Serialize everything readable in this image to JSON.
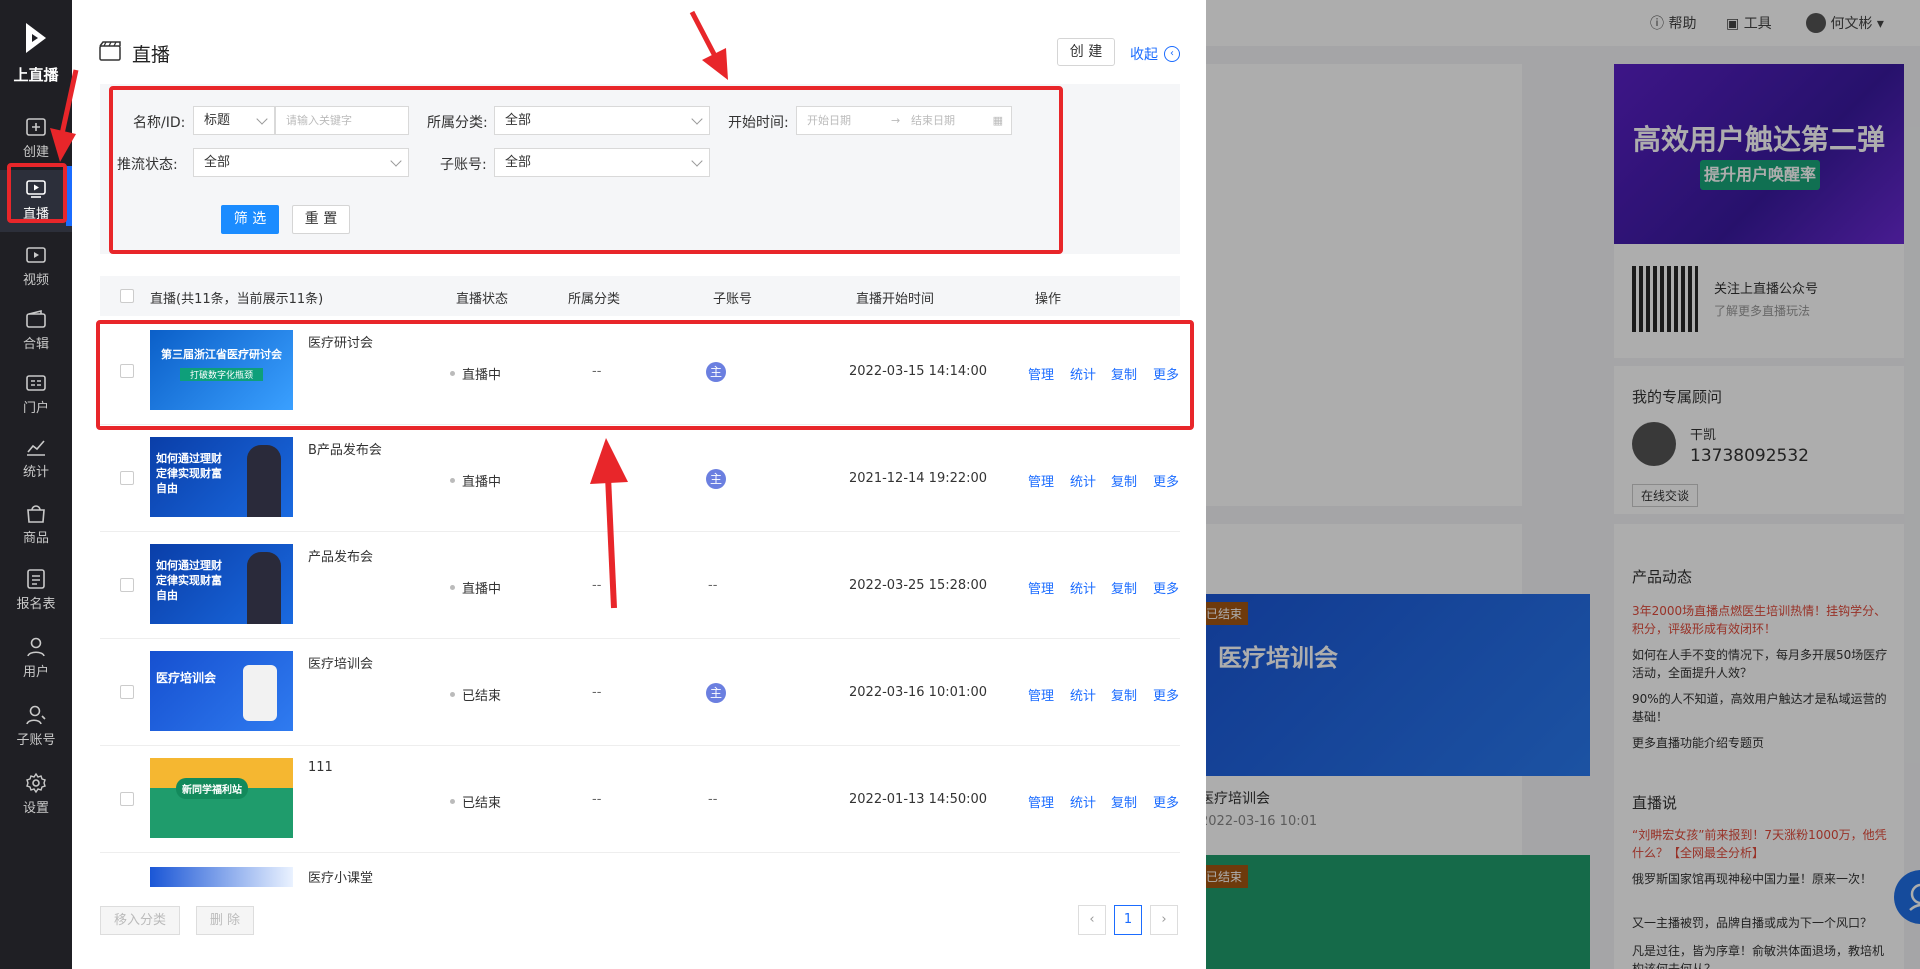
{
  "nav": {
    "logo_text": "上直播",
    "items": [
      {
        "label": "创建",
        "icon": "plus-box-icon"
      },
      {
        "label": "直播",
        "icon": "play-monitor-icon"
      },
      {
        "label": "视频",
        "icon": "video-icon"
      },
      {
        "label": "合辑",
        "icon": "wallet-icon"
      },
      {
        "label": "门户",
        "icon": "portal-icon"
      },
      {
        "label": "统计",
        "icon": "chart-line-icon"
      },
      {
        "label": "商品",
        "icon": "shopping-bag-icon"
      },
      {
        "label": "报名表",
        "icon": "form-icon"
      },
      {
        "label": "用户",
        "icon": "user-icon"
      },
      {
        "label": "子账号",
        "icon": "sub-account-icon"
      },
      {
        "label": "设置",
        "icon": "gear-icon"
      }
    ]
  },
  "topbar": {
    "help": "帮助",
    "tools": "工具",
    "user": "何文彬"
  },
  "right_panel": {
    "banner_title": "高效用户触达第二弹",
    "banner_sub": "提升用户唤醒率",
    "follow_title": "关注上直播公众号",
    "follow_sub": "了解更多直播玩法",
    "advisor_title": "我的专属顾问",
    "advisor_name": "干凯",
    "advisor_phone": "13738092532",
    "advisor_btn": "在线交谈",
    "news_title": "产品动态",
    "news": [
      "3年2000场直播点燃医生培训热情！挂钩学分、积分，评级形成有效闭环！",
      "如何在人手不变的情况下，每月多开展50场医疗活动，全面提升人效？",
      "90%的人不知道，高效用户触达才是私域运营的基础！",
      "更多直播功能介绍专题页"
    ],
    "say_title": "直播说",
    "say": [
      "“刘畊宏女孩”前来报到！7天涨粉1000万，他凭什么？【全网最全分析】",
      "俄罗斯国家馆再现神秘中国力量！原来一次！",
      "又一主播被罚，品牌自播或成为下一个风口？",
      "凡是过往，皆为序章！俞敏洪体面退场，教培机构该何去何从？"
    ]
  },
  "bg_cards": [
    {
      "badge": "已结束",
      "title": "医疗培训会",
      "time": "2022-03-16 10:01"
    },
    {
      "badge": "已结束"
    }
  ],
  "drawer": {
    "title": "直播",
    "create_btn": "创 建",
    "collapse": "收起",
    "filter": {
      "name_label": "名称/ID:",
      "name_type": "标题",
      "name_placeholder": "请输入关键字",
      "category_label": "所属分类:",
      "category_value": "全部",
      "start_label": "开始时间:",
      "start_placeholder": "开始日期",
      "end_placeholder": "结束日期",
      "push_label": "推流状态:",
      "push_value": "全部",
      "sub_label": "子账号:",
      "sub_value": "全部",
      "filter_btn": "筛 选",
      "reset_btn": "重 置"
    },
    "table": {
      "headers": [
        "直播(共11条，当前展示11条)",
        "直播状态",
        "所属分类",
        "子账号",
        "直播开始时间",
        "操作"
      ],
      "ops": [
        "管理",
        "统计",
        "复制",
        "更多"
      ],
      "rows": [
        {
          "name": "医疗研讨会",
          "status": "直播中",
          "category": "--",
          "sub": "主",
          "time": "2022-03-15 14:14:00",
          "thumb_text": "第三届浙江省医疗研讨会",
          "thumb_sub": "打破数字化瓶颈"
        },
        {
          "name": "B产品发布会",
          "status": "直播中",
          "category": "--",
          "sub": "主",
          "time": "2021-12-14 19:22:00",
          "thumb_text": "如何通过理财定律实现财富自由"
        },
        {
          "name": "产品发布会",
          "status": "直播中",
          "category": "--",
          "sub": "--",
          "time": "2022-03-25 15:28:00",
          "thumb_text": "如何通过理财定律实现财富自由"
        },
        {
          "name": "医疗培训会",
          "status": "已结束",
          "category": "--",
          "sub": "主",
          "time": "2022-03-16 10:01:00",
          "thumb_text": "医疗培训会"
        },
        {
          "name": "111",
          "status": "已结束",
          "category": "--",
          "sub": "--",
          "time": "2022-01-13 14:50:00",
          "thumb_text": "新同学福利站"
        },
        {
          "name": "医疗小课堂"
        }
      ]
    },
    "footer": {
      "move_btn": "移入分类",
      "delete_btn": "删 除",
      "page": "1"
    }
  },
  "colors": {
    "accent": "#1b6cff",
    "annotation": "#e8262a",
    "nav_bg": "#1f1f24"
  }
}
